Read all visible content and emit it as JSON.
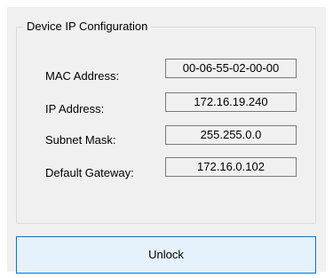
{
  "group": {
    "title": "Device IP Configuration"
  },
  "fields": [
    {
      "label": "MAC Address:",
      "value": "00-06-55-02-00-00"
    },
    {
      "label": "IP Address:",
      "value": "172.16.19.240"
    },
    {
      "label": "Subnet Mask:",
      "value": "255.255.0.0"
    },
    {
      "label": "Default Gateway:",
      "value": "172.16.0.102"
    }
  ],
  "unlock_button": {
    "label": "Unlock"
  }
}
